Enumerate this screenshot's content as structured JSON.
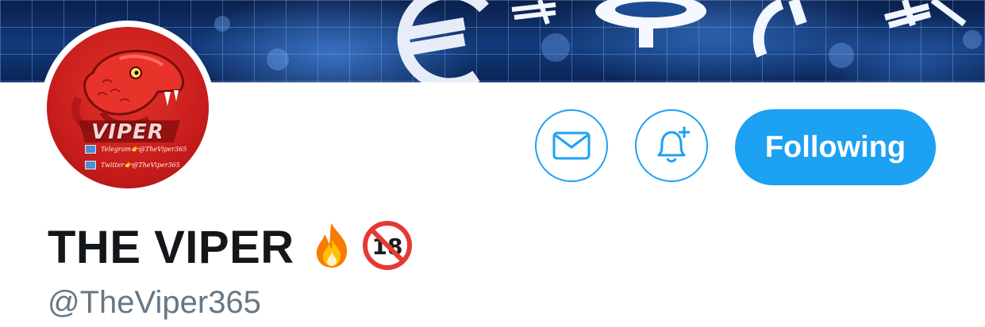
{
  "banner": {
    "icon": "currency-grid-banner"
  },
  "avatar": {
    "logo_text": "VIPER",
    "telegram_line": "Telegram👉@TheViper365",
    "twitter_line": "Twitter👉@TheViper365"
  },
  "actions": {
    "message_icon": "envelope-icon",
    "notify_icon": "bell-plus-icon",
    "follow_label": "Following"
  },
  "profile": {
    "display_name": "THE VIPER",
    "fire_icon": "fire-emoji",
    "no_under_18_icon": "no-one-under-18-emoji",
    "handle": "@TheViper365"
  },
  "colors": {
    "accent": "#1da1f2",
    "name": "#14171a",
    "handle": "#657786",
    "avatar_red": "#c81d1c"
  }
}
